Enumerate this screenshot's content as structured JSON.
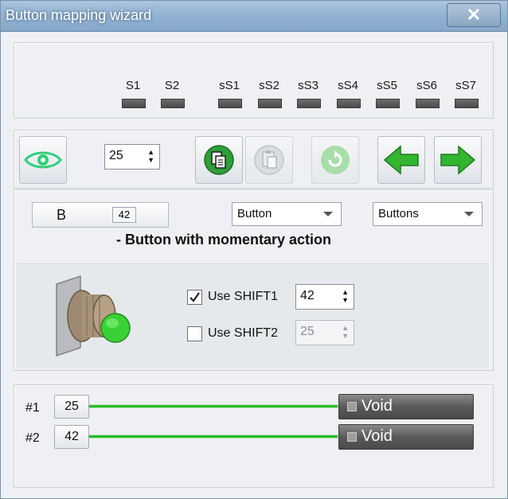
{
  "window": {
    "title": "Button mapping wizard",
    "close_symbol": "✕"
  },
  "shift_states": {
    "items": [
      {
        "label": "S1"
      },
      {
        "label": "S2"
      },
      {
        "label": "sS1"
      },
      {
        "label": "sS2"
      },
      {
        "label": "sS3"
      },
      {
        "label": "sS4"
      },
      {
        "label": "sS5"
      },
      {
        "label": "sS6"
      },
      {
        "label": "sS7"
      }
    ]
  },
  "toolbar": {
    "button_number": "25",
    "icons": [
      "eye-icon",
      "copy-icon",
      "paste-icon",
      "reset-icon",
      "arrow-left-icon",
      "arrow-right-icon"
    ]
  },
  "mapping": {
    "key_label": "B",
    "key_number": "42",
    "type_select": "Button",
    "category_select": "Buttons",
    "description": "- Button with momentary action"
  },
  "shift_options": {
    "shift1_label": "Use SHIFT1",
    "shift1_checked": true,
    "shift1_value": "42",
    "shift2_label": "Use SHIFT2",
    "shift2_checked": false,
    "shift2_value": "25"
  },
  "outputs": [
    {
      "label": "#1",
      "number": "25",
      "target": "Void"
    },
    {
      "label": "#2",
      "number": "42",
      "target": "Void"
    }
  ],
  "colors": {
    "accent_green": "#22c022",
    "titlebar": "#8fb0d1",
    "led": "#555555"
  }
}
